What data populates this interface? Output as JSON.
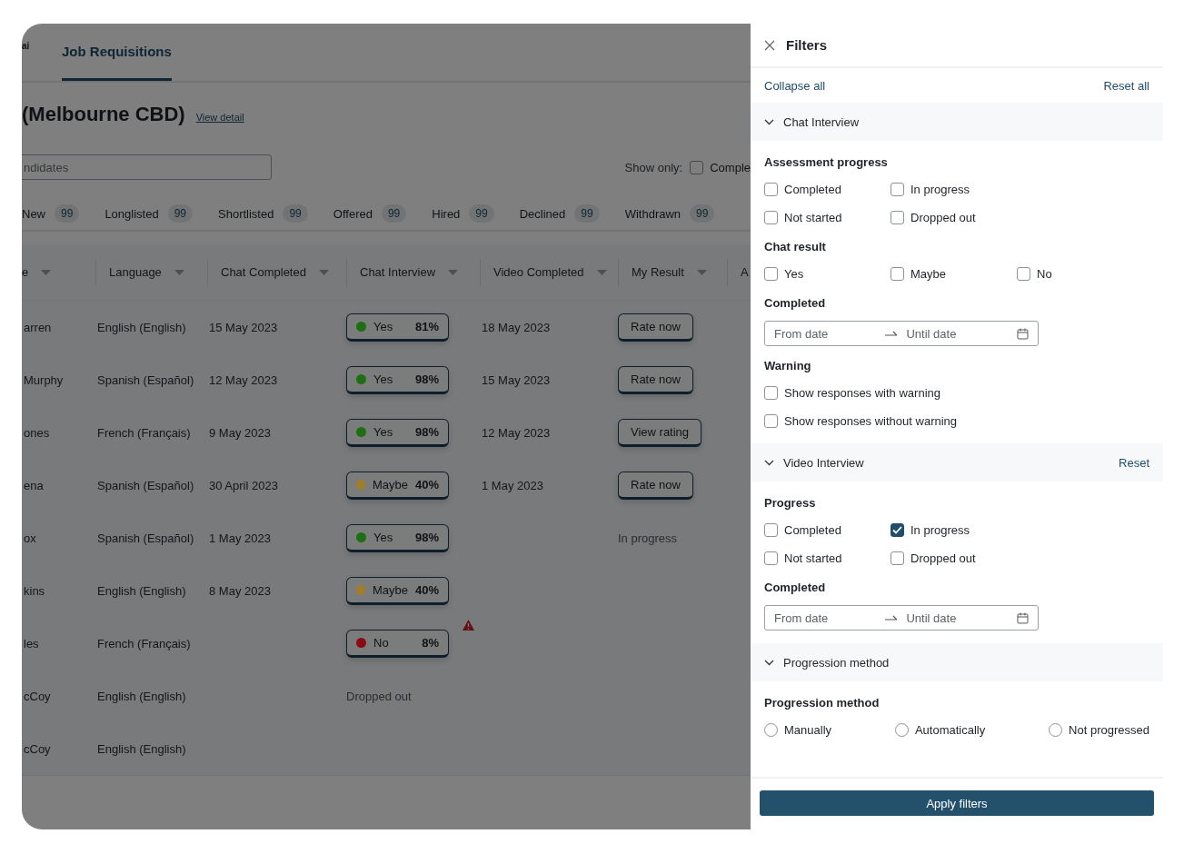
{
  "nav": {
    "logo": "ai",
    "tabs": [
      {
        "label": "Job Requisitions",
        "selected": true
      }
    ]
  },
  "header": {
    "title": "(Melbourne CBD)",
    "link": "View detail"
  },
  "search": {
    "placeholder": "ndidates"
  },
  "show_only": {
    "label": "Show only:",
    "options": [
      {
        "label": "Comple",
        "checked": false
      }
    ]
  },
  "stages": [
    {
      "label": "New",
      "count": "99"
    },
    {
      "label": "Longlisted",
      "count": "99"
    },
    {
      "label": "Shortlisted",
      "count": "99"
    },
    {
      "label": "Offered",
      "count": "99"
    },
    {
      "label": "Hired",
      "count": "99"
    },
    {
      "label": "Declined",
      "count": "99"
    },
    {
      "label": "Withdrawn",
      "count": "99"
    }
  ],
  "table": {
    "columns": [
      "e",
      "Language",
      "Chat Completed",
      "Chat Interview",
      "Video Completed",
      "My Result",
      "A"
    ],
    "rows": [
      {
        "name": "arren",
        "language": "English (English)",
        "chat_completed": "15 May 2023",
        "chat": {
          "kind": "chip",
          "result": "Yes",
          "score": "81%",
          "color": "#1e6e14"
        },
        "video_completed": "18 May 2023",
        "my_result": {
          "kind": "button",
          "label": "Rate now"
        },
        "warning": false
      },
      {
        "name": "Murphy",
        "language": "Spanish (Español)",
        "chat_completed": "12 May 2023",
        "chat": {
          "kind": "chip",
          "result": "Yes",
          "score": "98%",
          "color": "#1e6e14"
        },
        "video_completed": "15 May 2023",
        "my_result": {
          "kind": "button",
          "label": "Rate now"
        },
        "warning": false
      },
      {
        "name": "ones",
        "language": "French (Français)",
        "chat_completed": "9 May 2023",
        "chat": {
          "kind": "chip",
          "result": "Yes",
          "score": "98%",
          "color": "#1e6e14"
        },
        "video_completed": "12 May 2023",
        "my_result": {
          "kind": "button",
          "label": "View rating"
        },
        "warning": false
      },
      {
        "name": "ena",
        "language": "Spanish (Español)",
        "chat_completed": "30 April 2023",
        "chat": {
          "kind": "chip",
          "result": "Maybe",
          "score": "40%",
          "color": "#a07d28"
        },
        "video_completed": "1 May 2023",
        "my_result": {
          "kind": "button",
          "label": "Rate now"
        },
        "warning": false
      },
      {
        "name": "ox",
        "language": "Spanish (Español)",
        "chat_completed": "1 May 2023",
        "chat": {
          "kind": "chip",
          "result": "Yes",
          "score": "98%",
          "color": "#1e6e14"
        },
        "my_result": {
          "kind": "text",
          "label": "In progress"
        },
        "warning": false
      },
      {
        "name": "kins",
        "language": "English (English)",
        "chat_completed": "8 May 2023",
        "chat": {
          "kind": "chip",
          "result": "Maybe",
          "score": "40%",
          "color": "#a07d28"
        },
        "warning": false
      },
      {
        "name": "les",
        "language": "French (Français)",
        "chat": {
          "kind": "chip",
          "result": "No",
          "score": "8%",
          "color": "#8c0a14"
        },
        "warning": true
      },
      {
        "name": "cCoy",
        "language": "English (English)",
        "chat": {
          "kind": "text",
          "label": "Dropped out"
        },
        "warning": false
      },
      {
        "name": "cCoy",
        "language": "English (English)",
        "warning": false
      }
    ]
  },
  "drawer": {
    "title": "Filters",
    "collapse_all": "Collapse all",
    "reset_all": "Reset all",
    "sections": [
      {
        "title": "Chat Interview",
        "expanded": true,
        "groups": [
          {
            "kind": "checkbox",
            "title": "Assessment progress",
            "options": [
              {
                "label": "Completed",
                "checked": false
              },
              {
                "label": "In progress",
                "checked": false
              },
              {
                "label": "Not started",
                "checked": false
              },
              {
                "label": "Dropped out",
                "checked": false
              }
            ]
          },
          {
            "kind": "checkbox3",
            "title": "Chat result",
            "options": [
              {
                "label": "Yes",
                "checked": false
              },
              {
                "label": "Maybe",
                "checked": false
              },
              {
                "label": "No",
                "checked": false
              }
            ]
          },
          {
            "kind": "date",
            "title": "Completed",
            "from": "From date",
            "until": "Until date"
          },
          {
            "kind": "checklist",
            "title": "Warning",
            "options": [
              {
                "label": "Show responses with warning",
                "checked": false
              },
              {
                "label": "Show responses without warning",
                "checked": false
              }
            ]
          }
        ]
      },
      {
        "title": "Video Interview",
        "expanded": true,
        "reset": "Reset",
        "groups": [
          {
            "kind": "checkbox",
            "title": "Progress",
            "options": [
              {
                "label": "Completed",
                "checked": false
              },
              {
                "label": "In progress",
                "checked": true
              },
              {
                "label": "Not started",
                "checked": false
              },
              {
                "label": "Dropped out",
                "checked": false
              }
            ]
          },
          {
            "kind": "date",
            "title": "Completed",
            "from": "From date",
            "until": "Until date"
          }
        ]
      },
      {
        "title": "Progression method",
        "expanded": true,
        "groups": [
          {
            "kind": "radio",
            "title": "Progression method",
            "options": [
              {
                "label": "Manually",
                "selected": false
              },
              {
                "label": "Automatically",
                "selected": false
              },
              {
                "label": "Not progressed",
                "selected": false
              }
            ]
          }
        ]
      }
    ],
    "apply": "Apply filters"
  }
}
